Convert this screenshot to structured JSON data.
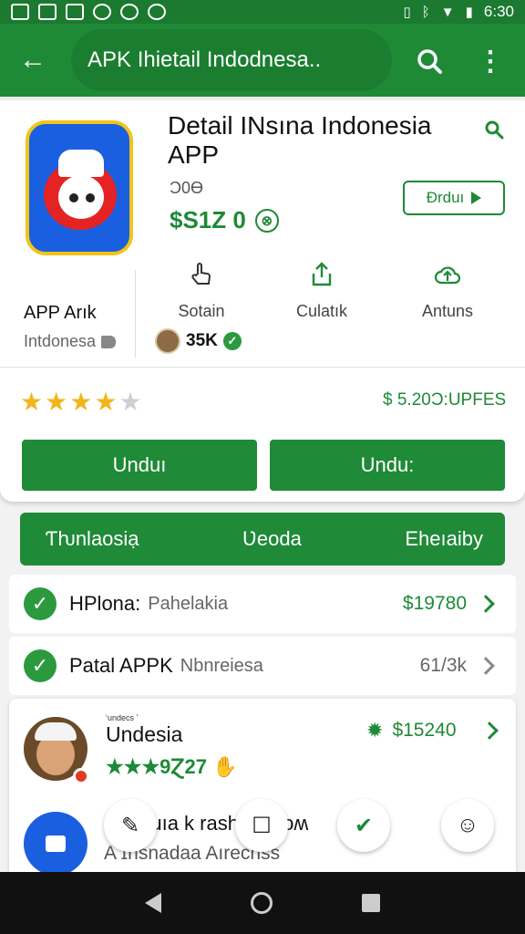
{
  "status_bar": {
    "time": "6:30"
  },
  "app_bar": {
    "title": "APK Ihietail Indodnesa..",
    "icons": [
      "back-arrow-icon",
      "search-icon",
      "more-vert-icon"
    ]
  },
  "app": {
    "title": "Detail INsına Indonesia APP",
    "subtitle": "Ɔ0Ɵ",
    "price": "$S1Z 0",
    "price_badge": "⊗",
    "unduh_outline": "Ɖrduı",
    "developer": "APP Arık",
    "developer_location": "Intdonesa"
  },
  "actions": [
    {
      "label": "Sotain",
      "icon": "hand-pointer-icon"
    },
    {
      "label": "Culatık",
      "icon": "share-upload-icon"
    },
    {
      "label": "Antuns",
      "icon": "cloud-up-icon"
    }
  ],
  "user": {
    "count": "35K",
    "verified": "✓"
  },
  "rating": {
    "filled": 4,
    "total": 5,
    "price_text": "$ 5.20Ͻ:UPFES"
  },
  "buttons": {
    "left": "Unduı",
    "right": "Undu:"
  },
  "tabs": [
    "Ƭƕnlaosiạ",
    "Ʋeoda",
    "Eheıaiby"
  ],
  "rows": [
    {
      "name": "HPlona:",
      "desc": "Pahelakia",
      "value": "$19780"
    },
    {
      "name": "Patal APPK",
      "desc": "Nbnreiesa",
      "value": "61/3k"
    }
  ],
  "bottom_card": {
    "tiny_text": "ʻundecs  ʼ",
    "title": "Undesia",
    "rating": "★★★9Ɀ27",
    "price": "$15240",
    "line2": "ɔnsaluıa k    rash   ɹ   ʹ: ɴoʍ",
    "line3": "A ɪnsnadaa Aırechss"
  },
  "colors": {
    "primary": "#1e8a36",
    "status": "#1b7a30",
    "star": "#f2b51d"
  }
}
